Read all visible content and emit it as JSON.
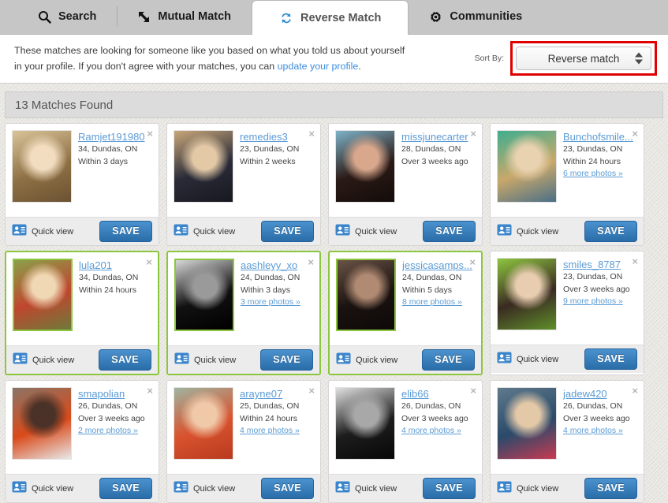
{
  "tabs": [
    {
      "label": "Search",
      "icon": "search-icon",
      "active": false
    },
    {
      "label": "Mutual Match",
      "icon": "mutual-arrows-icon",
      "active": false
    },
    {
      "label": "Reverse Match",
      "icon": "reverse-arrows-icon",
      "active": true
    },
    {
      "label": "Communities",
      "icon": "gear-icon",
      "active": false
    }
  ],
  "intro": {
    "line1": "These matches are looking for someone like you based on what you told us about yourself",
    "line2_before": "in your profile. If you don't agree with your matches, you can ",
    "link": "update your profile",
    "line2_after": "."
  },
  "sort": {
    "label": "Sort By:",
    "value": "Reverse match",
    "highlight_color": "#e00000"
  },
  "results": {
    "count_text": "13 Matches Found"
  },
  "labels": {
    "quick_view": "Quick view",
    "save": "SAVE",
    "close": "×"
  },
  "colors": {
    "link": "#5b9bd5",
    "highlight_border": "#8cc63f",
    "save_button": "#2a6da8"
  },
  "cards": [
    {
      "username": "Ramjet191980",
      "meta": "34, Dundas, ON",
      "last_online": "Within 3 days",
      "more_photos": "",
      "highlight": false,
      "photo": {
        "c1": "#d9c39a",
        "c2": "#8f7145",
        "c3": "#f2ddc0",
        "c4": "#6b5232"
      }
    },
    {
      "username": "remedies3",
      "meta": "23, Dundas, ON",
      "last_online": "Within 2 weeks",
      "more_photos": "",
      "highlight": false,
      "photo": {
        "c1": "#c9a87a",
        "c2": "#2a2b38",
        "c3": "#e3c9a6",
        "c4": "#17181f"
      }
    },
    {
      "username": "missjunecarter",
      "meta": "28, Dundas, ON",
      "last_online": "Over 3 weeks ago",
      "more_photos": "",
      "highlight": false,
      "photo": {
        "c1": "#7fb3c8",
        "c2": "#2b1a16",
        "c3": "#d8a78c",
        "c4": "#120c0a"
      }
    },
    {
      "username": "Bunchofsmile...",
      "meta": "23, Dundas, ON",
      "last_online": "Within 24 hours",
      "more_photos": "6 more photos »",
      "highlight": false,
      "photo": {
        "c1": "#3fae8f",
        "c2": "#c9a86a",
        "c3": "#e9d2b0",
        "c4": "#4a6f86"
      }
    },
    {
      "username": "lula201",
      "meta": "34, Dundas, ON",
      "last_online": "Within 24 hours",
      "more_photos": "",
      "highlight": true,
      "photo": {
        "c1": "#8aa04a",
        "c2": "#c0462e",
        "c3": "#f0d8b4",
        "c4": "#6d7a3a"
      }
    },
    {
      "username": "aashleyy_xo",
      "meta": "24, Dundas, ON",
      "last_online": "Within 3 days",
      "more_photos": "3 more photos »",
      "highlight": true,
      "photo": {
        "c1": "#d8d8d8",
        "c2": "#111111",
        "c3": "#9a9a9a",
        "c4": "#000000"
      }
    },
    {
      "username": "jessicasamps...",
      "meta": "24, Dundas, ON",
      "last_online": "Within 5 days",
      "more_photos": "8 more photos »",
      "highlight": true,
      "photo": {
        "c1": "#6a5346",
        "c2": "#1a1210",
        "c3": "#b08a72",
        "c4": "#0d0908"
      }
    },
    {
      "username": "smiles_8787",
      "meta": "23, Dundas, ON",
      "last_online": "Over 3 weeks ago",
      "more_photos": "9 more photos »",
      "highlight": false,
      "photo": {
        "c1": "#8ec63f",
        "c2": "#3a2a22",
        "c3": "#e8cdb0",
        "c4": "#5f8f2a"
      }
    },
    {
      "username": "smapolian",
      "meta": "26, Dundas, ON",
      "last_online": "Over 3 weeks ago",
      "more_photos": "2 more photos »",
      "highlight": false,
      "photo": {
        "c1": "#8a7466",
        "c2": "#d94a1a",
        "c3": "#4a3228",
        "c4": "#e8e8e8"
      }
    },
    {
      "username": "arayne07",
      "meta": "25, Dundas, ON",
      "last_online": "Within 24 hours",
      "more_photos": "4 more photos »",
      "highlight": false,
      "photo": {
        "c1": "#9fb4a0",
        "c2": "#d9532f",
        "c3": "#f0c9a8",
        "c4": "#b83a1e"
      }
    },
    {
      "username": "elib66",
      "meta": "26, Dundas, ON",
      "last_online": "Over 3 weeks ago",
      "more_photos": "4 more photos »",
      "highlight": false,
      "photo": {
        "c1": "#e0e0e0",
        "c2": "#1d1d1d",
        "c3": "#a8a8a8",
        "c4": "#070707"
      }
    },
    {
      "username": "jadew420",
      "meta": "26, Dundas, ON",
      "last_online": "Over 3 weeks ago",
      "more_photos": "4 more photos »",
      "highlight": false,
      "photo": {
        "c1": "#5f7a8c",
        "c2": "#2a4a6a",
        "c3": "#e4c9a8",
        "c4": "#c83a52"
      }
    }
  ]
}
